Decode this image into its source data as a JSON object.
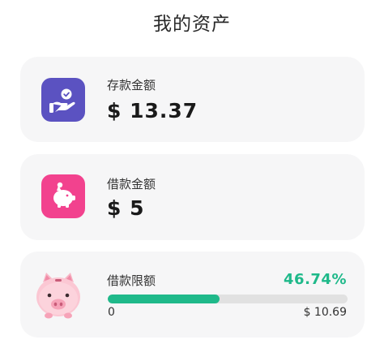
{
  "header": {
    "title": "我的资产"
  },
  "deposit": {
    "label": "存款金额",
    "amount": "$ 13.37",
    "icon": "hand-coin-icon",
    "color": "#5b52c1"
  },
  "loan": {
    "label": "借款金额",
    "amount": "$ 5",
    "icon": "piggy-bank-icon",
    "color": "#f2428e"
  },
  "limit": {
    "label": "借款限额",
    "percent_text": "46.74%",
    "progress": 0.4674,
    "min_text": "0",
    "max_text": "$ 10.69",
    "icon": "pig-illustration-icon",
    "color": "#1fb98a"
  }
}
